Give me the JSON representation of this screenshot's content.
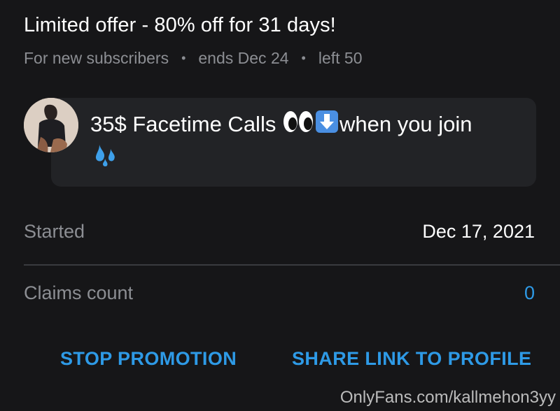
{
  "offer": {
    "title": "Limited offer - 80% off for 31 days!",
    "audience": "For new subscribers",
    "ends": "ends Dec 24",
    "left": "left 50"
  },
  "message": {
    "text_before": "35$ Facetime Calls",
    "text_after": "when you join",
    "emojis": [
      "eyes-icon",
      "down-arrow-icon",
      "sweat-droplets-icon"
    ]
  },
  "details": {
    "started_label": "Started",
    "started_value": "Dec 17, 2021",
    "claims_label": "Claims count",
    "claims_value": "0"
  },
  "actions": {
    "stop_label": "STOP PROMOTION",
    "share_label": "SHARE LINK TO PROFILE"
  },
  "watermark": "OnlyFans.com/kallmehon3yy",
  "colors": {
    "background": "#161618",
    "bubble": "#222326",
    "accent": "#2e9ae6",
    "muted": "#8c8e93"
  }
}
